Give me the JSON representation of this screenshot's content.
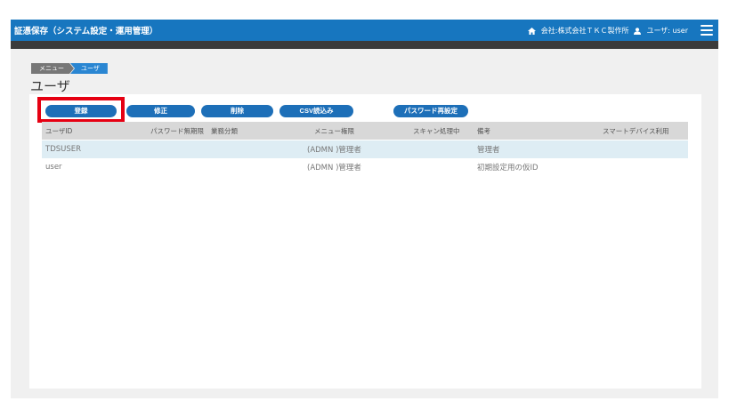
{
  "header": {
    "title": "証憑保存（システム設定・運用管理）",
    "company": "会社:株式会社ＴＫＣ製作所",
    "user": "ユーザ: user"
  },
  "breadcrumb": [
    "メニュー",
    "ユーザ"
  ],
  "page_title": "ユーザ",
  "toolbar": {
    "register": "登録",
    "edit": "修正",
    "delete": "削除",
    "csv_import": "CSV読込み",
    "password_reset": "パスワード再設定"
  },
  "table": {
    "columns": [
      "ユーザID",
      "パスワード無期限",
      "業務分類",
      "メニュー権限",
      "スキャン処理中",
      "備考",
      "スマートデバイス利用"
    ],
    "rows": [
      [
        "TDSUSER",
        "",
        "",
        "(ADMN )管理者",
        "",
        "管理者",
        ""
      ],
      [
        "user",
        "",
        "",
        "(ADMN )管理者",
        "",
        "初期設定用の仮ID",
        ""
      ]
    ]
  },
  "colors": {
    "header": "#1776bf",
    "button": "#1d6fb8",
    "highlight": "#e60012",
    "selected_row": "#deedf4"
  }
}
